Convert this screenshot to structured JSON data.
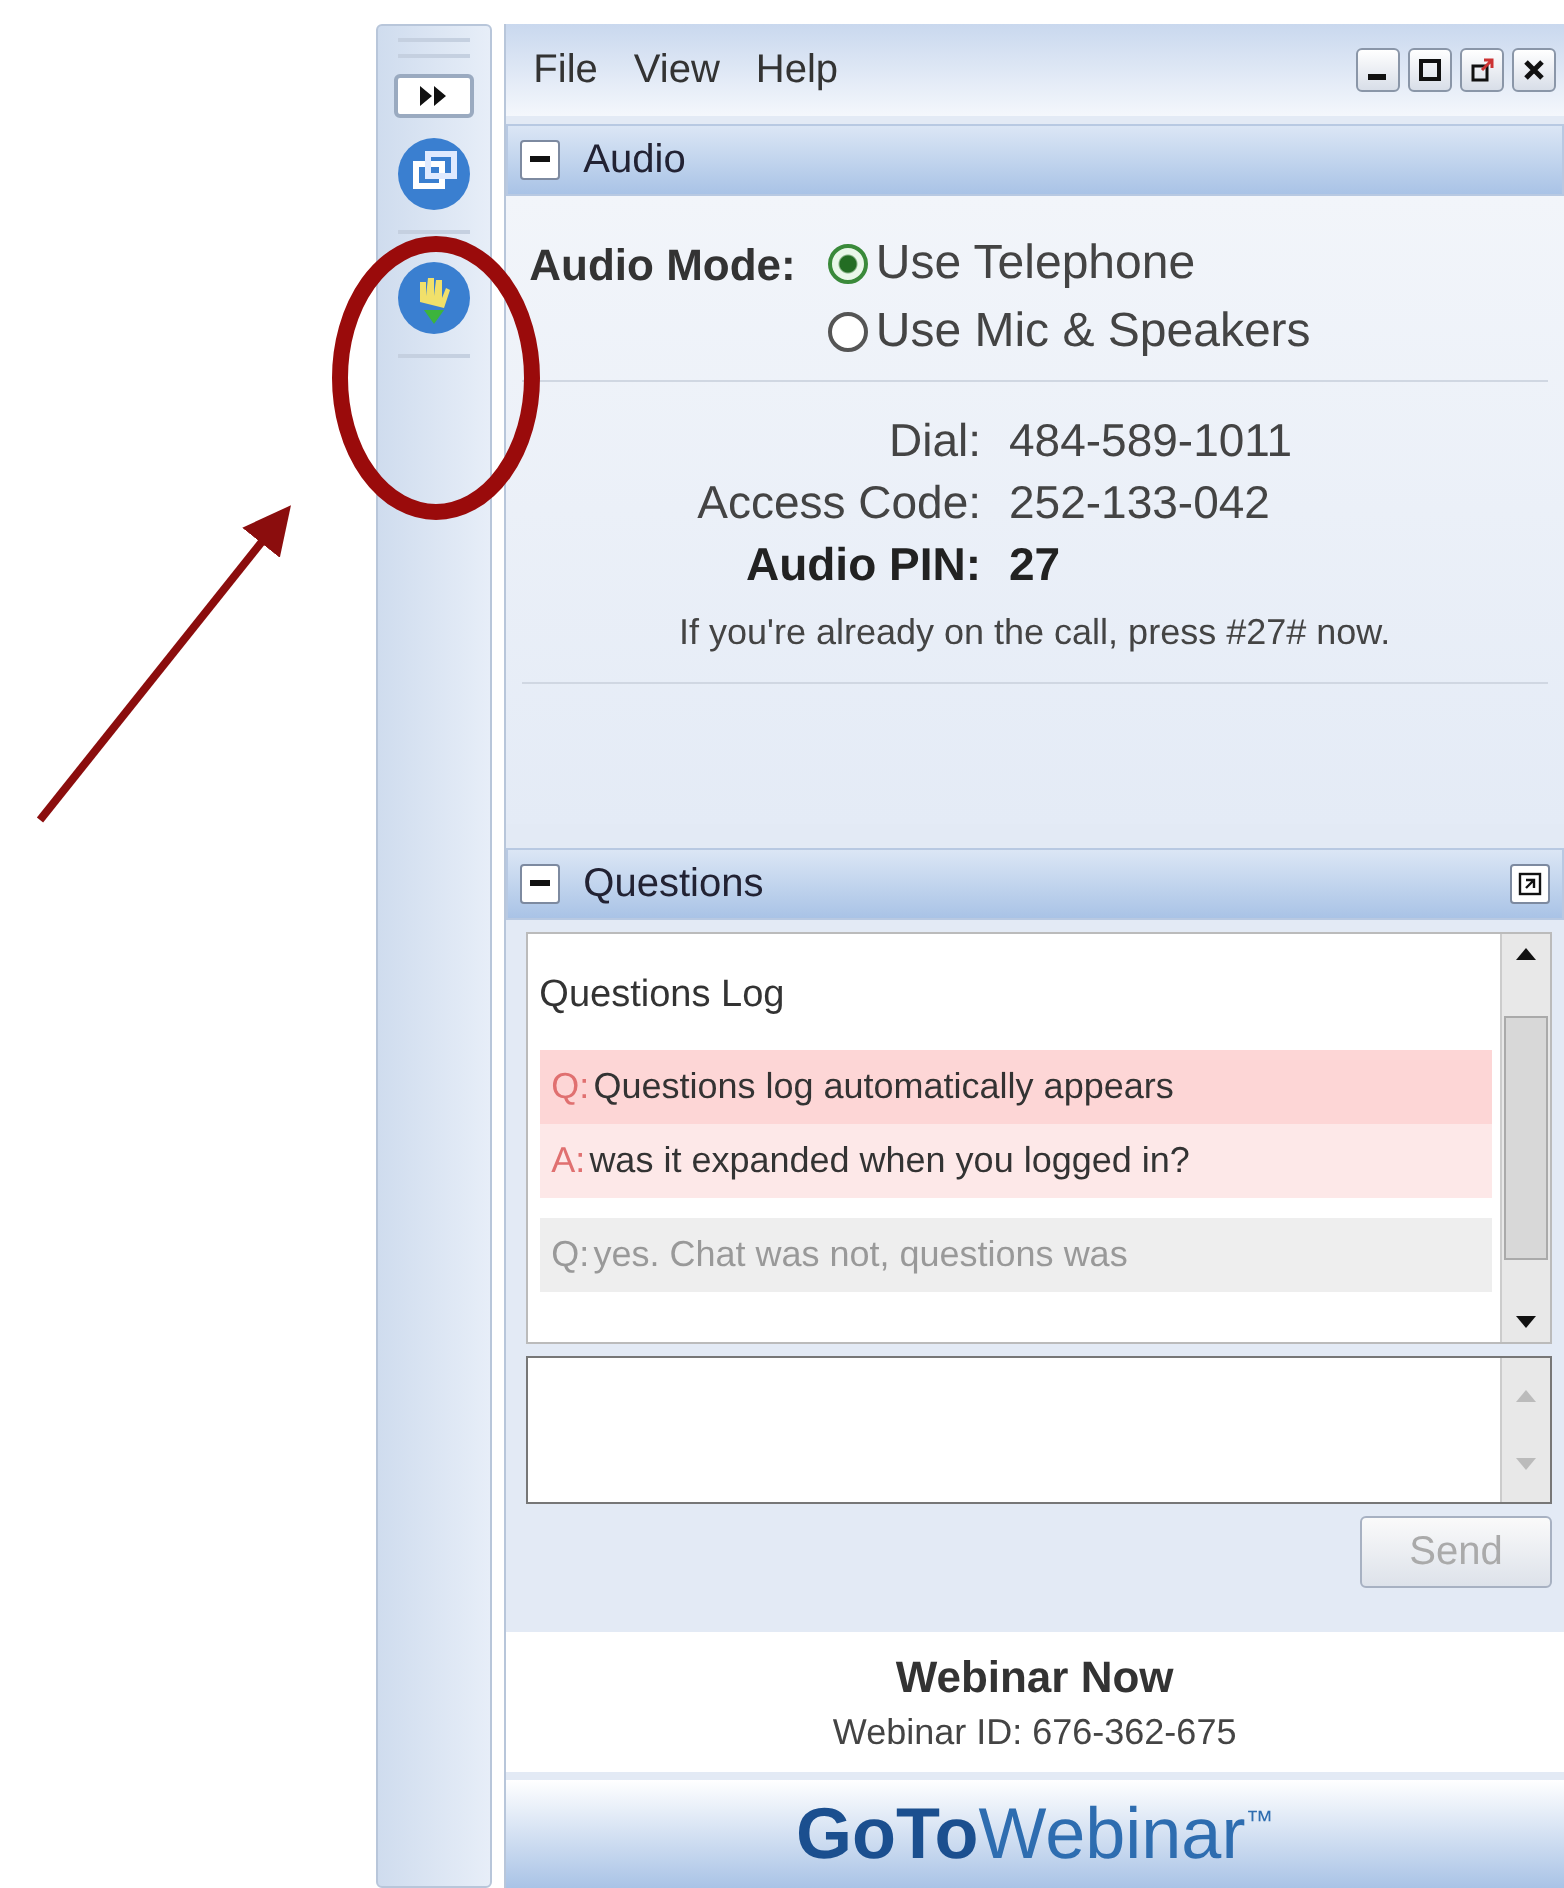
{
  "menu": [
    "File",
    "View",
    "Help"
  ],
  "audio": {
    "title": "Audio",
    "mode_label": "Audio Mode:",
    "options": [
      {
        "label": "Use Telephone",
        "selected": true
      },
      {
        "label": "Use Mic & Speakers",
        "selected": false
      }
    ],
    "details": [
      {
        "label": "Dial:",
        "value": "484-589-1011",
        "bold": false
      },
      {
        "label": "Access Code:",
        "value": "252-133-042",
        "bold": false
      },
      {
        "label": "Audio PIN:",
        "value": "27",
        "bold": true
      }
    ],
    "notice": "If you're already on the call, press #27# now."
  },
  "questions": {
    "title": "Questions",
    "log_title": "Questions Log",
    "entries": [
      {
        "prefix": "Q:",
        "text": "Questions log automatically appears",
        "selected": true
      },
      {
        "prefix": "A:",
        "text": "was it expanded when you logged in?",
        "selected": true
      },
      {
        "prefix": "Q:",
        "text": "yes.  Chat was not, questions was",
        "selected": false
      }
    ],
    "send": {
      "label": "Send",
      "disabled": true
    }
  },
  "webinar": {
    "name": "Webinar Now",
    "id_text": "Webinar ID: 676-362-675"
  },
  "logo": {
    "bold": "GoTo",
    "light": "Webinar",
    "mark": "™"
  }
}
